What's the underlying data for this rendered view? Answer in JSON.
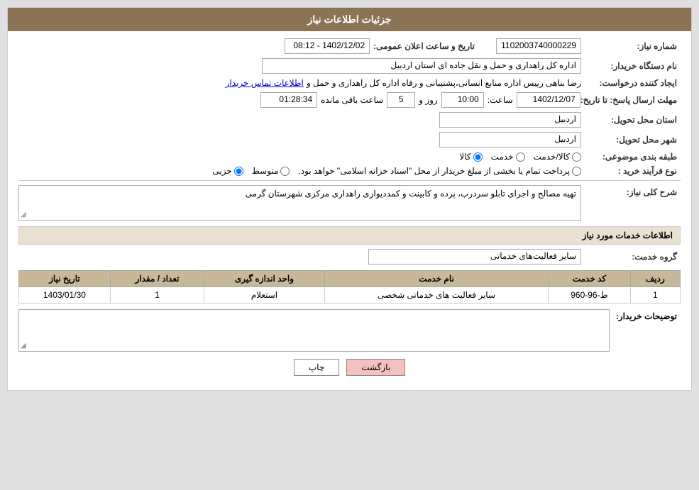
{
  "header": {
    "title": "جزئیات اطلاعات نیاز"
  },
  "fields": {
    "request_number_label": "شماره نیاز:",
    "request_number_value": "1102003740000229",
    "org_name_label": "نام دستگاه خریدار:",
    "org_name_value": "اداره کل راهداری و حمل و نقل جاده ای استان اردبیل",
    "creator_label": "ایجاد کننده درخواست:",
    "creator_value": "رضا بناهی رییس اداره منابع انسانی،پشتیبانی و رفاه اداره کل راهداری و حمل و",
    "creator_link": "اطلاعات تماس خریدار",
    "deadline_label": "مهلت ارسال پاسخ: تا تاریخ:",
    "deadline_date": "1402/12/07",
    "deadline_time_label": "ساعت:",
    "deadline_time": "10:00",
    "deadline_day_label": "روز و",
    "deadline_days": "5",
    "deadline_remaining_label": "ساعت باقی مانده",
    "deadline_remaining": "01:28:34",
    "province_label": "استان محل تحویل:",
    "province_value": "اردبیل",
    "city_label": "شهر محل تحویل:",
    "city_value": "اردبیل",
    "category_label": "طبقه بندی موضوعی:",
    "category_options": [
      "کالا",
      "خدمت",
      "کالا/خدمت"
    ],
    "category_selected": "کالا",
    "process_label": "نوع فرآیند خرید :",
    "process_options": [
      "جزیی",
      "متوسط",
      "پرداخت تمام یا بخشی از مبلغ خریدار از محل \"اسناد خزانه اسلامی\" خواهد بود."
    ],
    "process_selected_note": "پرداخت تمام یا بخشی از مبلغ خریدار از محل \"اسناد خزانه اسلامی\" خواهد بود.",
    "announcement_label": "تاریخ و ساعت اعلان عمومی:",
    "announcement_value": "1402/12/02 - 08:12",
    "description_section": "شرح کلی نیاز:",
    "description_value": "تهیه مصالح و اجرای تابلو سردرب، پرده و کابینت و کمددیواری راهداری مرکزی شهرستان گرمی",
    "services_section": "اطلاعات خدمات مورد نیاز",
    "service_group_label": "گروه خدمت:",
    "service_group_value": "سایر فعالیت‌های خدماتی",
    "table": {
      "headers": [
        "ردیف",
        "کد خدمت",
        "نام خدمت",
        "واحد اندازه گیری",
        "تعداد / مقدار",
        "تاریخ نیاز"
      ],
      "rows": [
        {
          "row": "1",
          "code": "ط-96-960",
          "name": "سایر فعالیت های خدماتی شخصی",
          "unit": "استعلام",
          "quantity": "1",
          "date": "1403/01/30"
        }
      ]
    },
    "buyer_desc_label": "توضیحات خریدار:",
    "buyer_desc_value": ""
  },
  "buttons": {
    "print": "چاپ",
    "back": "بازگشت"
  }
}
